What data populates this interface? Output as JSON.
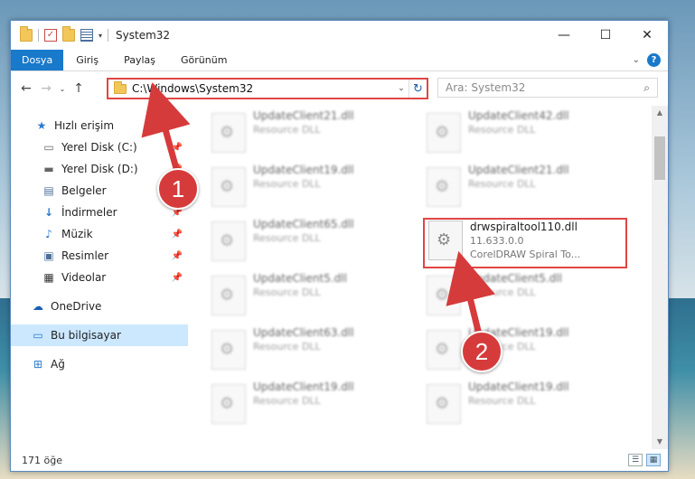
{
  "window": {
    "title": "System32",
    "controls": {
      "minimize": "—",
      "maximize": "☐",
      "close": "✕"
    }
  },
  "ribbon": {
    "tabs": [
      "Dosya",
      "Giriş",
      "Paylaş",
      "Görünüm"
    ],
    "help": "?"
  },
  "address": {
    "path": "C:\\Windows\\System32",
    "search_placeholder": "Ara: System32"
  },
  "nav": {
    "items": [
      {
        "label": "Hızlı erişim",
        "icon": "star-icon",
        "pinned": false
      },
      {
        "label": "Yerel Disk (C:)",
        "icon": "drive-icon",
        "pinned": true
      },
      {
        "label": "Yerel Disk (D:)",
        "icon": "drive-icon",
        "pinned": true
      },
      {
        "label": "Belgeler",
        "icon": "documents-icon",
        "pinned": true
      },
      {
        "label": "İndirmeler",
        "icon": "downloads-icon",
        "pinned": true
      },
      {
        "label": "Müzik",
        "icon": "music-icon",
        "pinned": true
      },
      {
        "label": "Resimler",
        "icon": "pictures-icon",
        "pinned": true
      },
      {
        "label": "Videolar",
        "icon": "videos-icon",
        "pinned": true
      },
      {
        "label": "OneDrive",
        "icon": "onedrive-icon",
        "pinned": false
      },
      {
        "label": "Bu bilgisayar",
        "icon": "computer-icon",
        "pinned": false
      },
      {
        "label": "Ağ",
        "icon": "network-icon",
        "pinned": false
      }
    ]
  },
  "files": [
    {
      "name": "UpdateClient21.dll",
      "sub": "Resource DLL",
      "blurred": true
    },
    {
      "name": "UpdateClient42.dll",
      "sub": "Resource DLL",
      "blurred": true
    },
    {
      "name": "UpdateClient19.dll",
      "sub": "Resource DLL",
      "blurred": true
    },
    {
      "name": "UpdateClient21.dll",
      "sub": "Resource DLL",
      "blurred": true
    },
    {
      "name": "UpdateClient65.dll",
      "sub": "Resource DLL",
      "blurred": true
    },
    {
      "name": "drwspiraltool110.dll",
      "sub": "11.633.0.0",
      "sub2": "CorelDRAW Spiral To...",
      "blurred": false
    },
    {
      "name": "UpdateClient5.dll",
      "sub": "Resource DLL",
      "blurred": true
    },
    {
      "name": "UpdateClient5.dll",
      "sub": "Resource DLL",
      "blurred": true
    },
    {
      "name": "UpdateClient63.dll",
      "sub": "Resource DLL",
      "blurred": true
    },
    {
      "name": "UpdateClient19.dll",
      "sub": "Resource DLL",
      "blurred": true
    },
    {
      "name": "UpdateClient19.dll",
      "sub": "Resource DLL",
      "blurred": true
    },
    {
      "name": "UpdateClient19.dll",
      "sub": "Resource DLL",
      "blurred": true
    }
  ],
  "status": {
    "count": "171 öğe"
  },
  "annotations": {
    "step1": "1",
    "step2": "2",
    "color": "#d63b3b"
  }
}
